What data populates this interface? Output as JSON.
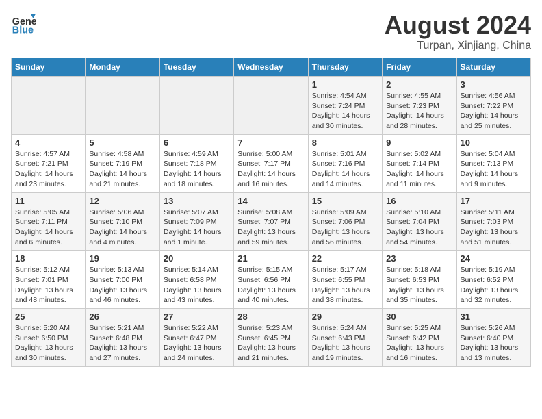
{
  "header": {
    "logo_general": "General",
    "logo_blue": "Blue",
    "month_title": "August 2024",
    "location": "Turpan, Xinjiang, China"
  },
  "weekdays": [
    "Sunday",
    "Monday",
    "Tuesday",
    "Wednesday",
    "Thursday",
    "Friday",
    "Saturday"
  ],
  "weeks": [
    [
      {
        "day": "",
        "info": ""
      },
      {
        "day": "",
        "info": ""
      },
      {
        "day": "",
        "info": ""
      },
      {
        "day": "",
        "info": ""
      },
      {
        "day": "1",
        "info": "Sunrise: 4:54 AM\nSunset: 7:24 PM\nDaylight: 14 hours\nand 30 minutes."
      },
      {
        "day": "2",
        "info": "Sunrise: 4:55 AM\nSunset: 7:23 PM\nDaylight: 14 hours\nand 28 minutes."
      },
      {
        "day": "3",
        "info": "Sunrise: 4:56 AM\nSunset: 7:22 PM\nDaylight: 14 hours\nand 25 minutes."
      }
    ],
    [
      {
        "day": "4",
        "info": "Sunrise: 4:57 AM\nSunset: 7:21 PM\nDaylight: 14 hours\nand 23 minutes."
      },
      {
        "day": "5",
        "info": "Sunrise: 4:58 AM\nSunset: 7:19 PM\nDaylight: 14 hours\nand 21 minutes."
      },
      {
        "day": "6",
        "info": "Sunrise: 4:59 AM\nSunset: 7:18 PM\nDaylight: 14 hours\nand 18 minutes."
      },
      {
        "day": "7",
        "info": "Sunrise: 5:00 AM\nSunset: 7:17 PM\nDaylight: 14 hours\nand 16 minutes."
      },
      {
        "day": "8",
        "info": "Sunrise: 5:01 AM\nSunset: 7:16 PM\nDaylight: 14 hours\nand 14 minutes."
      },
      {
        "day": "9",
        "info": "Sunrise: 5:02 AM\nSunset: 7:14 PM\nDaylight: 14 hours\nand 11 minutes."
      },
      {
        "day": "10",
        "info": "Sunrise: 5:04 AM\nSunset: 7:13 PM\nDaylight: 14 hours\nand 9 minutes."
      }
    ],
    [
      {
        "day": "11",
        "info": "Sunrise: 5:05 AM\nSunset: 7:11 PM\nDaylight: 14 hours\nand 6 minutes."
      },
      {
        "day": "12",
        "info": "Sunrise: 5:06 AM\nSunset: 7:10 PM\nDaylight: 14 hours\nand 4 minutes."
      },
      {
        "day": "13",
        "info": "Sunrise: 5:07 AM\nSunset: 7:09 PM\nDaylight: 14 hours\nand 1 minute."
      },
      {
        "day": "14",
        "info": "Sunrise: 5:08 AM\nSunset: 7:07 PM\nDaylight: 13 hours\nand 59 minutes."
      },
      {
        "day": "15",
        "info": "Sunrise: 5:09 AM\nSunset: 7:06 PM\nDaylight: 13 hours\nand 56 minutes."
      },
      {
        "day": "16",
        "info": "Sunrise: 5:10 AM\nSunset: 7:04 PM\nDaylight: 13 hours\nand 54 minutes."
      },
      {
        "day": "17",
        "info": "Sunrise: 5:11 AM\nSunset: 7:03 PM\nDaylight: 13 hours\nand 51 minutes."
      }
    ],
    [
      {
        "day": "18",
        "info": "Sunrise: 5:12 AM\nSunset: 7:01 PM\nDaylight: 13 hours\nand 48 minutes."
      },
      {
        "day": "19",
        "info": "Sunrise: 5:13 AM\nSunset: 7:00 PM\nDaylight: 13 hours\nand 46 minutes."
      },
      {
        "day": "20",
        "info": "Sunrise: 5:14 AM\nSunset: 6:58 PM\nDaylight: 13 hours\nand 43 minutes."
      },
      {
        "day": "21",
        "info": "Sunrise: 5:15 AM\nSunset: 6:56 PM\nDaylight: 13 hours\nand 40 minutes."
      },
      {
        "day": "22",
        "info": "Sunrise: 5:17 AM\nSunset: 6:55 PM\nDaylight: 13 hours\nand 38 minutes."
      },
      {
        "day": "23",
        "info": "Sunrise: 5:18 AM\nSunset: 6:53 PM\nDaylight: 13 hours\nand 35 minutes."
      },
      {
        "day": "24",
        "info": "Sunrise: 5:19 AM\nSunset: 6:52 PM\nDaylight: 13 hours\nand 32 minutes."
      }
    ],
    [
      {
        "day": "25",
        "info": "Sunrise: 5:20 AM\nSunset: 6:50 PM\nDaylight: 13 hours\nand 30 minutes."
      },
      {
        "day": "26",
        "info": "Sunrise: 5:21 AM\nSunset: 6:48 PM\nDaylight: 13 hours\nand 27 minutes."
      },
      {
        "day": "27",
        "info": "Sunrise: 5:22 AM\nSunset: 6:47 PM\nDaylight: 13 hours\nand 24 minutes."
      },
      {
        "day": "28",
        "info": "Sunrise: 5:23 AM\nSunset: 6:45 PM\nDaylight: 13 hours\nand 21 minutes."
      },
      {
        "day": "29",
        "info": "Sunrise: 5:24 AM\nSunset: 6:43 PM\nDaylight: 13 hours\nand 19 minutes."
      },
      {
        "day": "30",
        "info": "Sunrise: 5:25 AM\nSunset: 6:42 PM\nDaylight: 13 hours\nand 16 minutes."
      },
      {
        "day": "31",
        "info": "Sunrise: 5:26 AM\nSunset: 6:40 PM\nDaylight: 13 hours\nand 13 minutes."
      }
    ]
  ]
}
